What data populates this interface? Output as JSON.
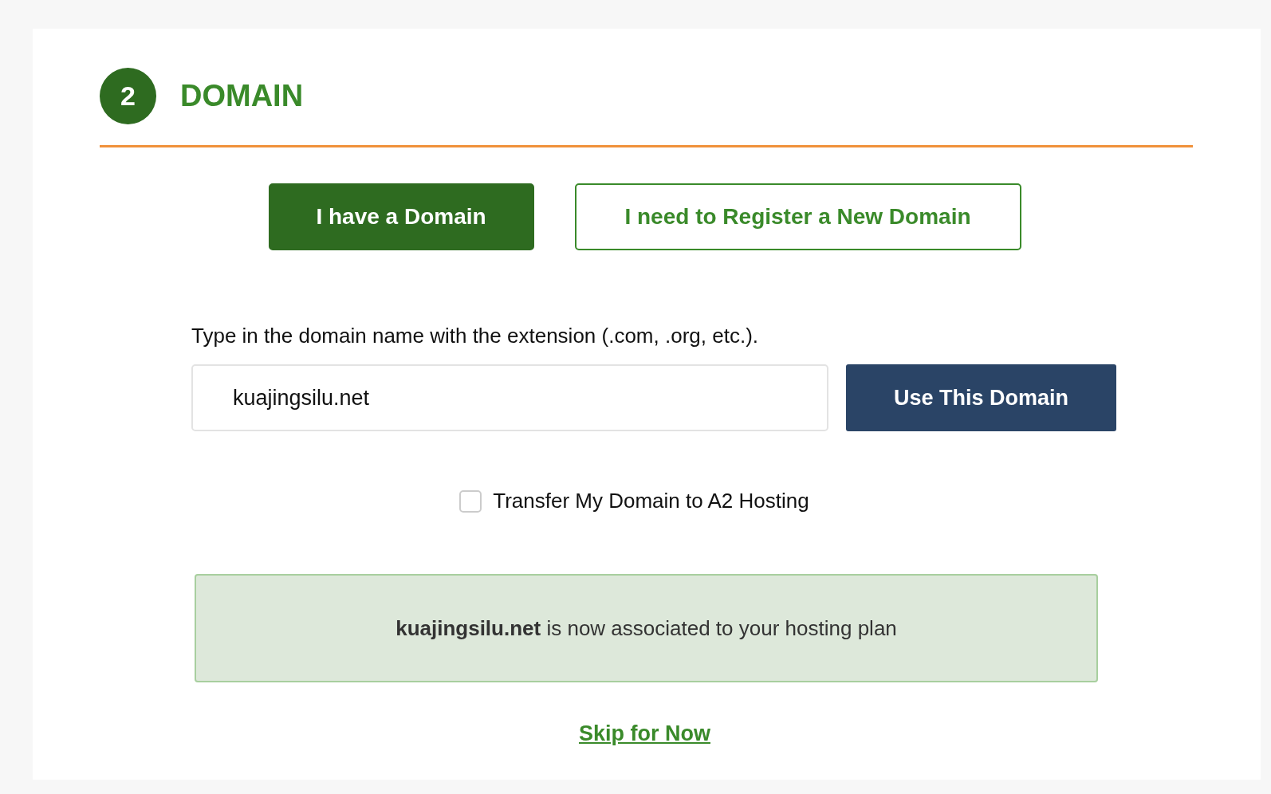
{
  "step": {
    "number": "2",
    "title": "DOMAIN"
  },
  "options": [
    {
      "label": "I have a Domain",
      "selected": true
    },
    {
      "label": "I need to Register a New Domain",
      "selected": false
    }
  ],
  "instruction": "Type in the domain name with the extension (.com, .org, etc.).",
  "domain_field": {
    "value": "kuajingsilu.net"
  },
  "submit_button": "Use This Domain",
  "transfer_checkbox": {
    "label": "Transfer My Domain to A2 Hosting",
    "checked": false
  },
  "alert": {
    "text": "**kuajingsilu.net** is now associated to your hosting plan"
  },
  "skip_link": "Skip for Now"
}
